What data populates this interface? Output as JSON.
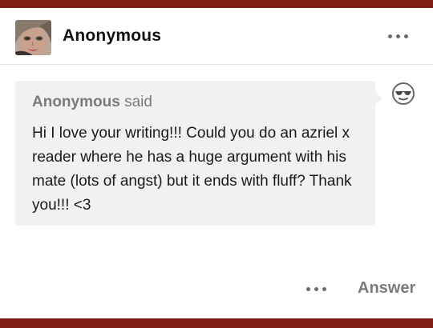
{
  "post": {
    "username": "Anonymous",
    "asker_name": "Anonymous",
    "asker_said": "said",
    "question": "Hi I love your writing!!! Could you do an azriel x reader where he has a huge argument with his mate (lots of angst) but it ends with fluff? Thank you!!! <3",
    "answer_label": "Answer"
  },
  "icons": {
    "avatar": "avatar-photo",
    "more_top": "more-options-icon",
    "anon": "anonymous-sunglasses-icon",
    "more_bottom": "more-options-icon"
  },
  "colors": {
    "frame": "#7e1d12",
    "bubble": "#f1f1f1"
  }
}
